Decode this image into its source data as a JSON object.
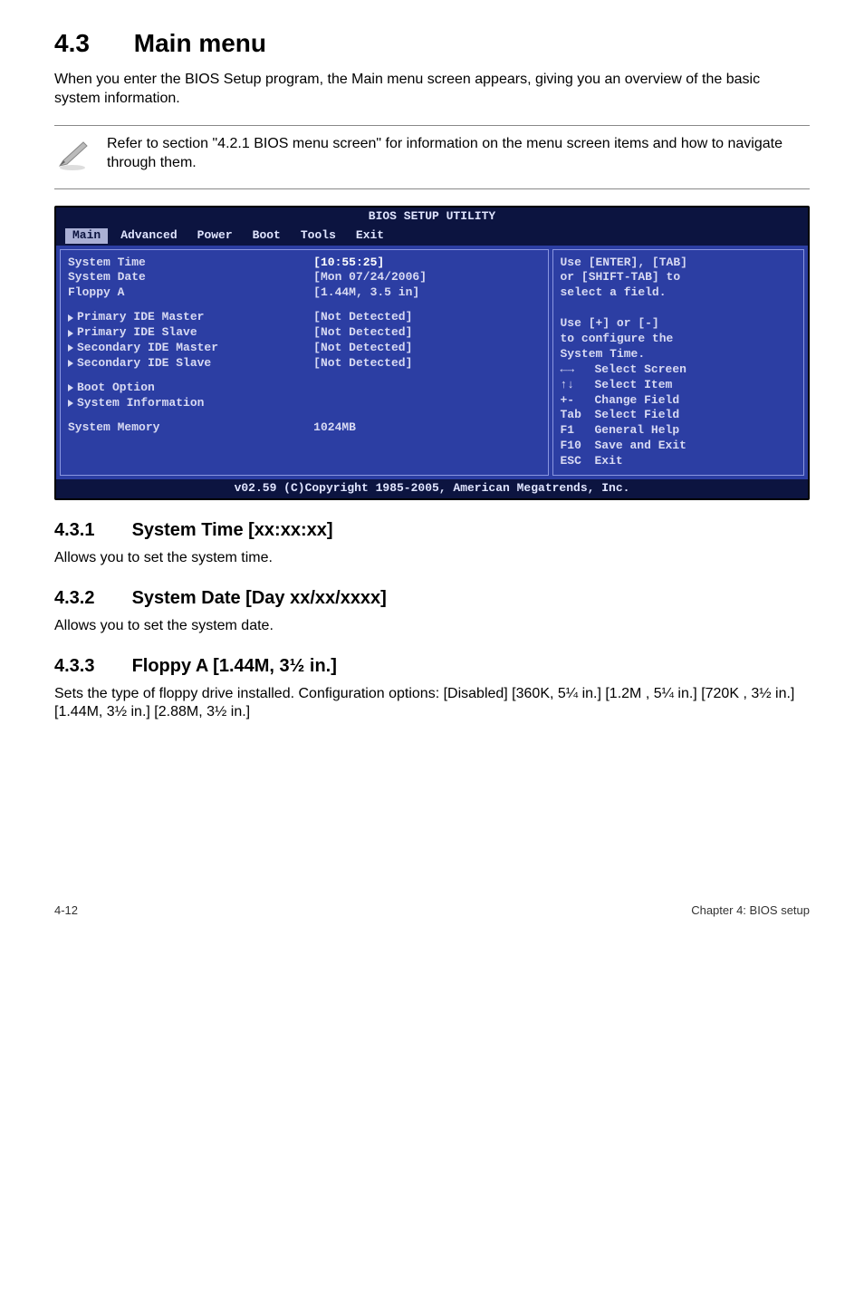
{
  "h1": {
    "num": "4.3",
    "title": "Main menu"
  },
  "intro": "When you enter the BIOS Setup program, the Main menu screen appears, giving you an overview of the basic system information.",
  "note": "Refer to section \"4.2.1  BIOS menu screen\" for information on the menu screen items and how to navigate through them.",
  "bios": {
    "title": "BIOS SETUP UTILITY",
    "tabs": [
      "Main",
      "Advanced",
      "Power",
      "Boot",
      "Tools",
      "Exit"
    ],
    "active_tab": "Main",
    "rows_a": [
      {
        "label": "System Time",
        "value": "[10:55:25]"
      },
      {
        "label": "System Date",
        "value": "[Mon 07/24/2006]"
      },
      {
        "label": "Floppy A",
        "value": "[1.44M, 3.5 in]"
      }
    ],
    "rows_b": [
      {
        "label": "Primary IDE Master",
        "value": "[Not Detected]"
      },
      {
        "label": "Primary IDE Slave",
        "value": "[Not Detected]"
      },
      {
        "label": "Secondary IDE Master",
        "value": "[Not Detected]"
      },
      {
        "label": "Secondary IDE Slave",
        "value": "[Not Detected]"
      }
    ],
    "rows_c": [
      {
        "label": "Boot Option",
        "value": ""
      },
      {
        "label": "System Information",
        "value": ""
      }
    ],
    "rows_d": [
      {
        "label": "System Memory",
        "value": "1024MB"
      }
    ],
    "help_top": "Use [ENTER], [TAB]\nor [SHIFT-TAB] to\nselect a field.\n\nUse [+] or [-]\nto configure the\nSystem Time.",
    "help_keys": [
      {
        "key": "←→",
        "desc": "Select Screen"
      },
      {
        "key": "↑↓",
        "desc": "Select Item"
      },
      {
        "key": "+-",
        "desc": "Change Field"
      },
      {
        "key": "Tab",
        "desc": "Select Field"
      },
      {
        "key": "F1",
        "desc": "General Help"
      },
      {
        "key": "F10",
        "desc": "Save and Exit"
      },
      {
        "key": "ESC",
        "desc": "Exit"
      }
    ],
    "copyright": "v02.59 (C)Copyright 1985-2005, American Megatrends, Inc."
  },
  "s431": {
    "num": "4.3.1",
    "title": "System Time [xx:xx:xx]",
    "text": "Allows you to set the system time."
  },
  "s432": {
    "num": "4.3.2",
    "title": "System Date [Day xx/xx/xxxx]",
    "text": "Allows you to set the system date."
  },
  "s433": {
    "num": "4.3.3",
    "title": "Floppy A [1.44M, 3½ in.]",
    "text": "Sets the type of floppy drive installed. Configuration options: [Disabled] [360K, 5¼ in.] [1.2M , 5¼ in.] [720K , 3½ in.] [1.44M, 3½ in.] [2.88M, 3½ in.]"
  },
  "footer": {
    "left": "4-12",
    "right": "Chapter 4: BIOS setup"
  }
}
